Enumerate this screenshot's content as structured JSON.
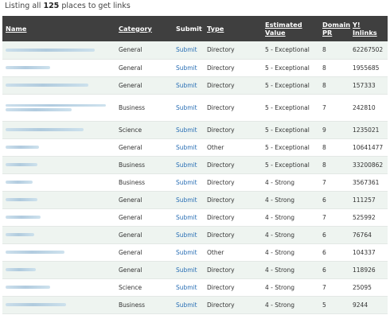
{
  "intro": {
    "prefix": "Listing all",
    "count": "125",
    "suffix": "places to get links"
  },
  "columns": {
    "name": "Name",
    "category": "Category",
    "submit": "Submit",
    "type": "Type",
    "value_line1": "Estimated",
    "value_line2": "Value",
    "pr_line1": "Domain",
    "pr_line2": "PR",
    "inlinks_line1": "Y!",
    "inlinks_line2": "Inlinks"
  },
  "rows": [
    {
      "category": "General",
      "submit": "Submit",
      "type": "Directory",
      "value": "5 - Exceptional",
      "pr": "8",
      "inlinks": "62267502"
    },
    {
      "category": "General",
      "submit": "Submit",
      "type": "Directory",
      "value": "5 - Exceptional",
      "pr": "8",
      "inlinks": "1955685"
    },
    {
      "category": "General",
      "submit": "Submit",
      "type": "Directory",
      "value": "5 - Exceptional",
      "pr": "8",
      "inlinks": "157333"
    },
    {
      "category": "Business",
      "submit": "Submit",
      "type": "Directory",
      "value": "5 - Exceptional",
      "pr": "7",
      "inlinks": "242810"
    },
    {
      "category": "Science",
      "submit": "Submit",
      "type": "Directory",
      "value": "5 - Exceptional",
      "pr": "9",
      "inlinks": "1235021"
    },
    {
      "category": "General",
      "submit": "Submit",
      "type": "Other",
      "value": "5 - Exceptional",
      "pr": "8",
      "inlinks": "10641477"
    },
    {
      "category": "Business",
      "submit": "Submit",
      "type": "Directory",
      "value": "5 - Exceptional",
      "pr": "8",
      "inlinks": "33200862"
    },
    {
      "category": "Business",
      "submit": "Submit",
      "type": "Directory",
      "value": "4 - Strong",
      "pr": "7",
      "inlinks": "3567361"
    },
    {
      "category": "General",
      "submit": "Submit",
      "type": "Directory",
      "value": "4 - Strong",
      "pr": "6",
      "inlinks": "111257"
    },
    {
      "category": "General",
      "submit": "Submit",
      "type": "Directory",
      "value": "4 - Strong",
      "pr": "7",
      "inlinks": "525992"
    },
    {
      "category": "General",
      "submit": "Submit",
      "type": "Directory",
      "value": "4 - Strong",
      "pr": "6",
      "inlinks": "76764"
    },
    {
      "category": "General",
      "submit": "Submit",
      "type": "Other",
      "value": "4 - Strong",
      "pr": "6",
      "inlinks": "104337"
    },
    {
      "category": "General",
      "submit": "Submit",
      "type": "Directory",
      "value": "4 - Strong",
      "pr": "6",
      "inlinks": "118926"
    },
    {
      "category": "Science",
      "submit": "Submit",
      "type": "Directory",
      "value": "4 - Strong",
      "pr": "7",
      "inlinks": "25095"
    },
    {
      "category": "Business",
      "submit": "Submit",
      "type": "Directory",
      "value": "4 - Strong",
      "pr": "5",
      "inlinks": "9244"
    }
  ]
}
